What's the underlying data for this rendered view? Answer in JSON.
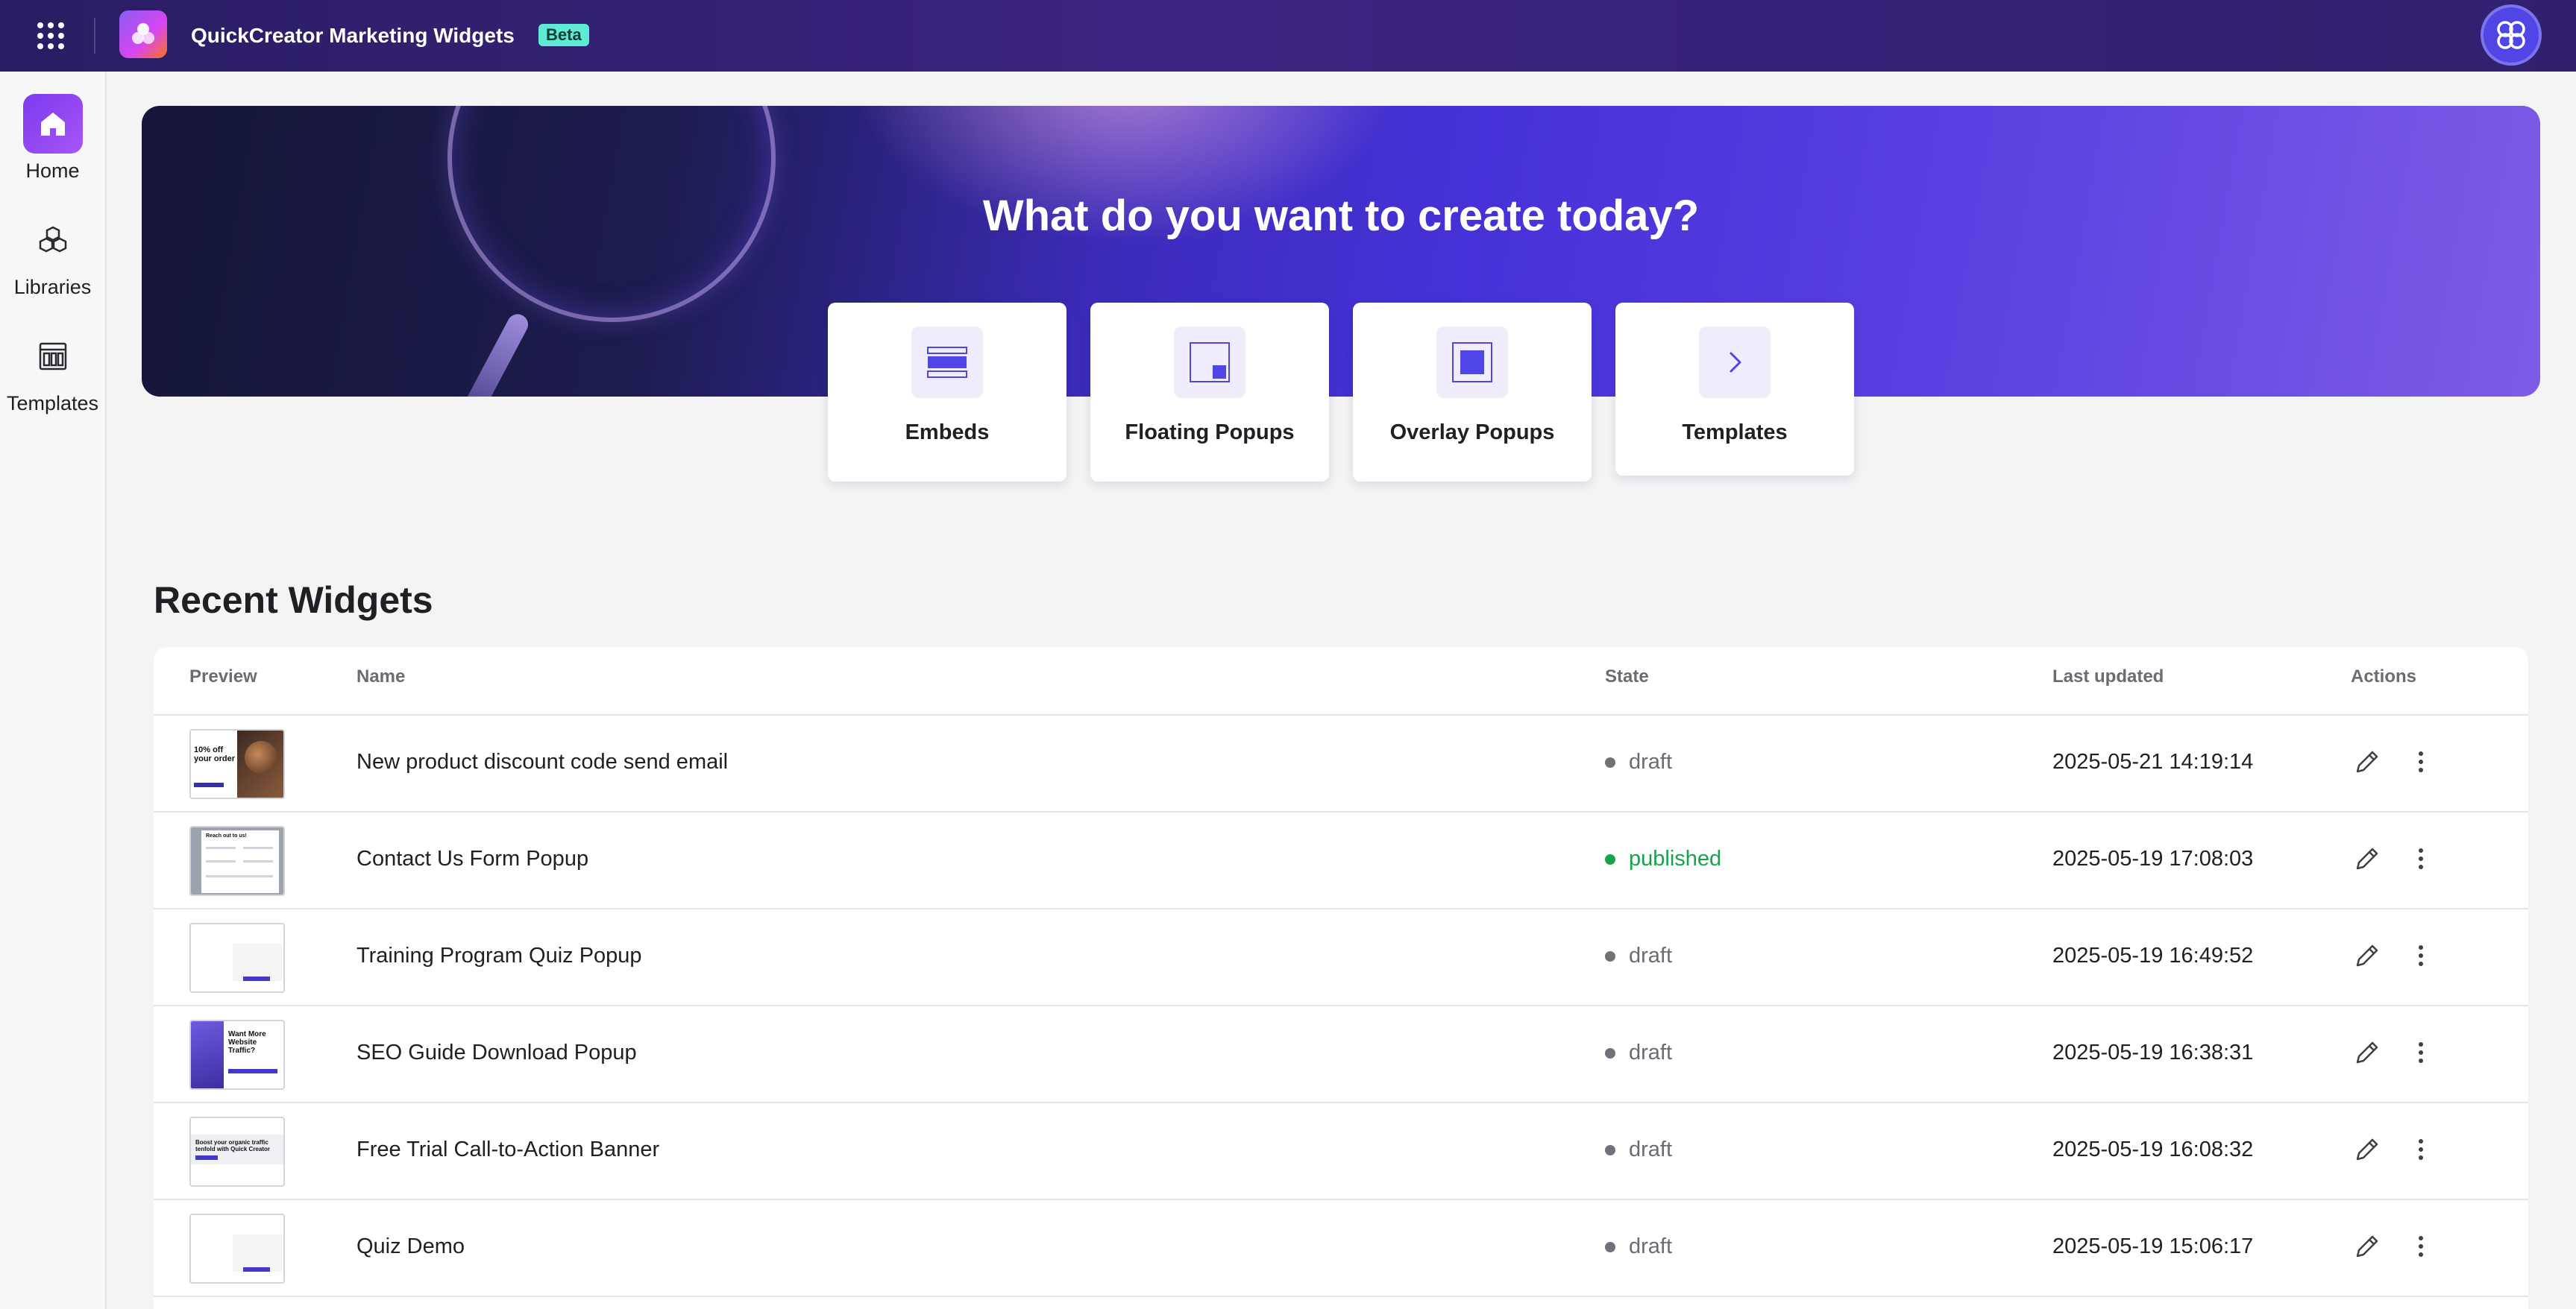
{
  "app": {
    "title": "QuickCreator Marketing Widgets",
    "badge": "Beta"
  },
  "colors": {
    "accent": "#4f46e5",
    "topbar": "#2a1d63",
    "draft": "#71717a",
    "published": "#16a34a"
  },
  "sidebar": {
    "items": [
      {
        "label": "Home",
        "icon": "home-icon",
        "active": true
      },
      {
        "label": "Libraries",
        "icon": "libraries-icon",
        "active": false
      },
      {
        "label": "Templates",
        "icon": "templates-icon",
        "active": false
      }
    ]
  },
  "hero": {
    "title": "What do you want to create today?"
  },
  "create_cards": [
    {
      "label": "Embeds",
      "icon": "embed-icon"
    },
    {
      "label": "Floating Popups",
      "icon": "floating-popup-icon"
    },
    {
      "label": "Overlay Popups",
      "icon": "overlay-popup-icon"
    },
    {
      "label": "Templates",
      "icon": "chevron-right-icon"
    }
  ],
  "recent": {
    "title": "Recent Widgets",
    "columns": {
      "preview": "Preview",
      "name": "Name",
      "state": "State",
      "updated": "Last updated",
      "actions": "Actions"
    },
    "rows": [
      {
        "name": "New product discount code send email",
        "state": "draft",
        "updated": "2025-05-21 14:19:14",
        "thumb_text": "10% off your order"
      },
      {
        "name": "Contact Us Form Popup",
        "state": "published",
        "updated": "2025-05-19 17:08:03",
        "thumb_text": "Reach out to us!"
      },
      {
        "name": "Training Program Quiz Popup",
        "state": "draft",
        "updated": "2025-05-19 16:49:52",
        "thumb_text": ""
      },
      {
        "name": "SEO Guide Download Popup",
        "state": "draft",
        "updated": "2025-05-19 16:38:31",
        "thumb_text": "Want More Website Traffic?"
      },
      {
        "name": "Free Trial Call-to-Action Banner",
        "state": "draft",
        "updated": "2025-05-19 16:08:32",
        "thumb_text": "Boost your organic traffic tenfold with Quick Creator"
      },
      {
        "name": "Quiz Demo",
        "state": "draft",
        "updated": "2025-05-19 15:06:17",
        "thumb_text": ""
      }
    ]
  }
}
